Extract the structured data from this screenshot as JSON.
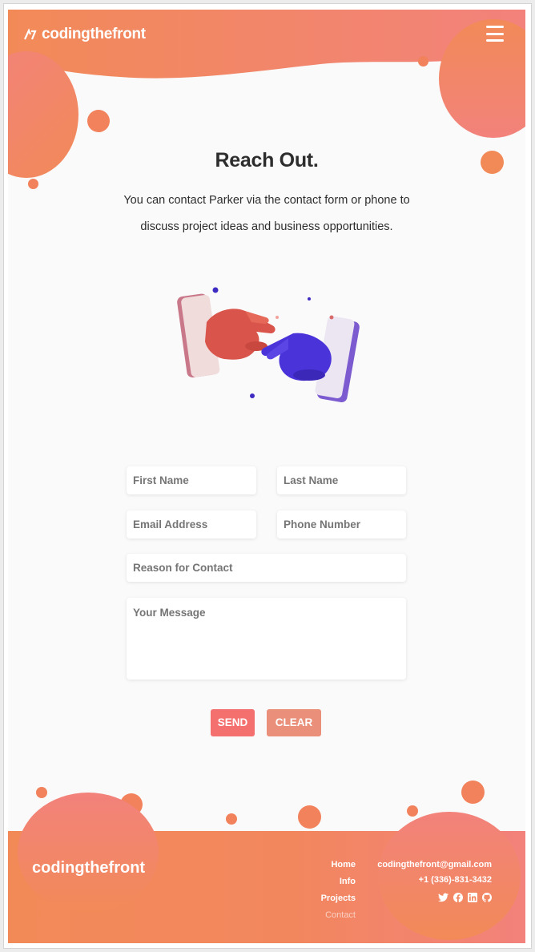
{
  "header": {
    "logo_text": "codingthefront",
    "menu_icon": "hamburger-menu-icon"
  },
  "main": {
    "title": "Reach Out.",
    "intro_line1": "You can contact Parker via the contact form or phone to",
    "intro_line2": "discuss project ideas and business opportunities."
  },
  "form": {
    "first_name_placeholder": "First Name",
    "last_name_placeholder": "Last Name",
    "email_placeholder": "Email Address",
    "phone_placeholder": "Phone Number",
    "reason_placeholder": "Reason for Contact",
    "message_placeholder": "Your Message",
    "send_label": "SEND",
    "clear_label": "CLEAR"
  },
  "footer": {
    "brand": "codingthefront",
    "nav": [
      {
        "label": "Home"
      },
      {
        "label": "Info"
      },
      {
        "label": "Projects"
      },
      {
        "label": "Contact"
      }
    ],
    "email": "codingthefront@gmail.com",
    "phone": "+1 (336)-831-3432",
    "socials": [
      "twitter-icon",
      "facebook-icon",
      "linkedin-icon",
      "github-icon"
    ]
  },
  "colors": {
    "accent_orange": "#f28a58",
    "accent_pink": "#f2827b",
    "send_button": "#f4706e",
    "clear_button": "#e98f7a"
  }
}
